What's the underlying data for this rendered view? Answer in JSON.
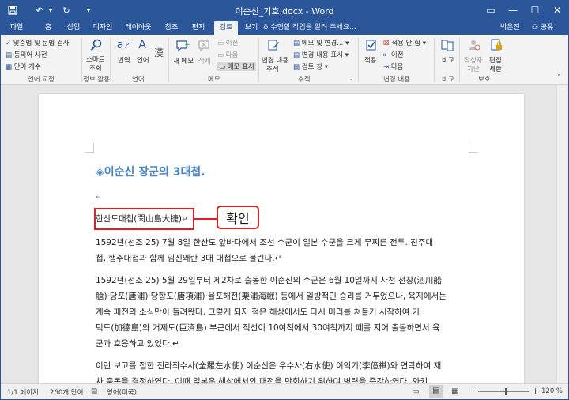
{
  "title_bar": {
    "window_title": "이순신_기호.docx - Word",
    "qat": {
      "save": "save-icon",
      "undo": "↶",
      "redo": "↻",
      "customize": "▾"
    },
    "controls": {
      "ribbon_display": "▭",
      "minimize": "—",
      "maximize": "☐",
      "close": "✕"
    }
  },
  "tabs": [
    {
      "label": "파일",
      "active": false
    },
    {
      "label": "홈",
      "active": false
    },
    {
      "label": "삽입",
      "active": false
    },
    {
      "label": "디자인",
      "active": false
    },
    {
      "label": "레이아웃",
      "active": false
    },
    {
      "label": "참조",
      "active": false
    },
    {
      "label": "편지",
      "active": false
    },
    {
      "label": "검토",
      "active": true
    },
    {
      "label": "보기",
      "active": false
    }
  ],
  "tell_me": "수행할 작업을 알려 주세요...",
  "user": {
    "name": "박은진",
    "share": "공유"
  },
  "ribbon": {
    "proofing": {
      "spell_grammar": "맞춤법 및 문법 검사",
      "thesaurus": "동의어 사전",
      "word_count": "단어 개수",
      "group": "언어 교정"
    },
    "insights": {
      "smart_lookup": [
        "스마트",
        "조회"
      ],
      "group": "정보 활용"
    },
    "language": {
      "translate": "번역",
      "language": "언어",
      "hanja": "漢",
      "group": "언어"
    },
    "comments": {
      "new_comment": "새 메모",
      "delete": "삭제",
      "previous": "이전",
      "next": "다음",
      "show_comments": "메모 표시",
      "group": "메모"
    },
    "tracking": {
      "track_changes": [
        "변경 내용",
        "추적"
      ],
      "markup_select": "메모 및 변경...",
      "show_markup": "변경 내용 표시",
      "reviewing_pane": "검토 창",
      "group": "추적"
    },
    "changes": {
      "accept": "적용",
      "reject": "적용 안 함",
      "previous": "이전",
      "next": "다음",
      "group": "변경 내용"
    },
    "compare": {
      "compare": "비교",
      "group": "비교"
    },
    "protect": {
      "block_authors": [
        "작성자",
        "차단"
      ],
      "restrict_editing": [
        "편집",
        "제한"
      ],
      "group": "보호"
    }
  },
  "document": {
    "heading": "◈이순신 장군의 3대첩.",
    "heading_mark": "↵",
    "empty_para_mark": "↵",
    "highlighted_line": "한산도대첩(閑山島大捷)",
    "highlighted_mark": "↵",
    "callout": "확인",
    "lines": [
      "1592년(선조 25) 7월 8일 한산도 앞바다에서 조선 수군이 일본 수군을 크게 무찌른 전투. 진주대",
      "첩, 행주대첩과 함께 임진왜란 3대 대첩으로 불린다.↵",
      "1592년(선조 25) 5월 29일부터 제2차로 출동한 이순신의 수군은 6월 10일까지 사천 선창(泗川船",
      "艙)·당포(唐浦)·당항포(唐項浦)·율포해전(栗浦海戰) 등에서 일방적인 승리를 거두었으나, 육지에서는",
      "계속 패전의 소식만이 들려왔다. 그렇게 되자 적은 해상에서도 다시 머리를 쳐들기 시작하여 가",
      "덕도(加德島)와 거제도(巨濟島) 부근에서 적선이 10여척에서 30여척까지 떼를 지어 출몰하면서 육",
      "군과 호응하고 있었다.↵",
      "이런 보고를 접한 전라좌수사(全羅左水使) 이순신은 우수사(右水使) 이억기(李億祺)와 연락하여 재",
      "차 출동을 결정하였다. 이때 일본은 해상에서의 패전을 만회하기 위하여 병력을 증강하였다. 와키"
    ]
  },
  "status_bar": {
    "page": "1/1 페이지",
    "words": "260개 단어",
    "proofing_icon": "proofing-icon",
    "language": "영어(미국)",
    "zoom_out": "−",
    "zoom_in": "+",
    "zoom": "120 %",
    "zoom_level": 0.55
  },
  "colors": {
    "accent": "#2b579a",
    "heading": "#4a86c5",
    "callout": "#e02020"
  }
}
